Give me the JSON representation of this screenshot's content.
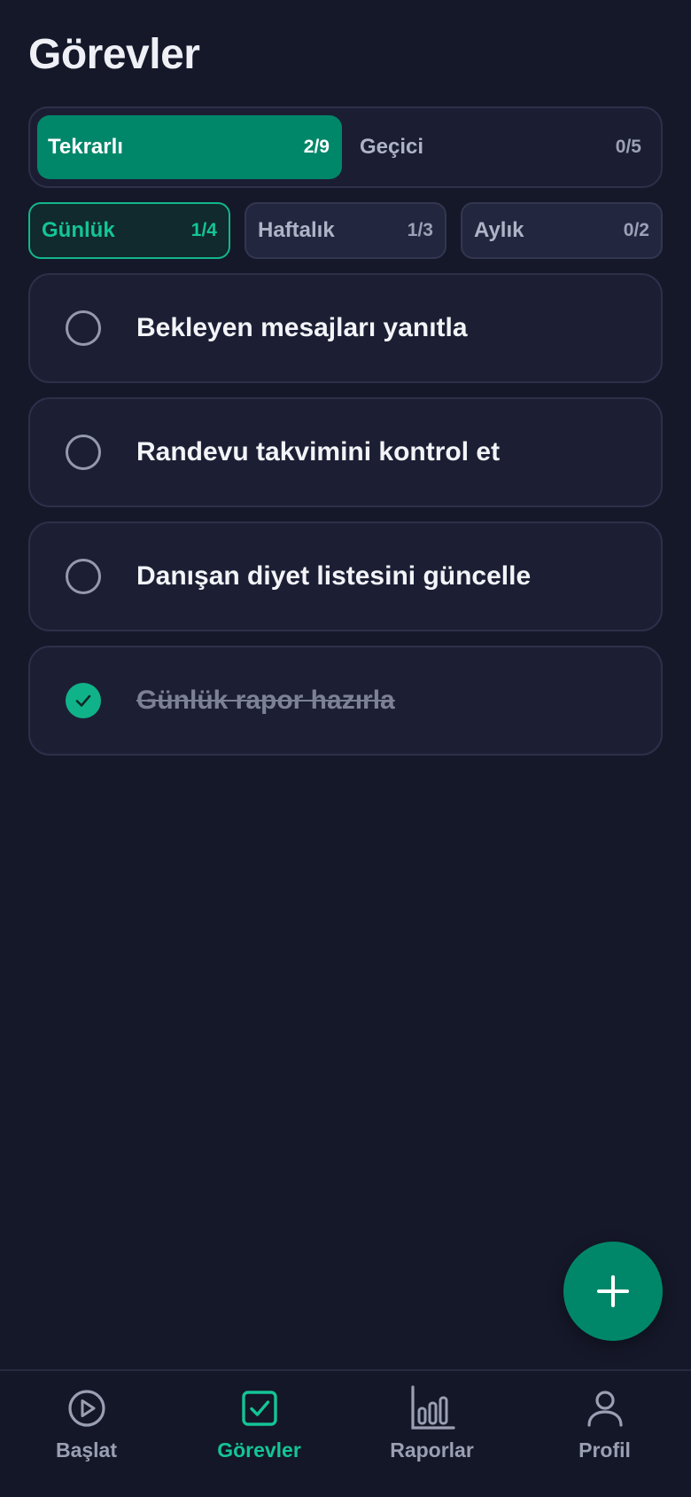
{
  "page": {
    "title": "Görevler"
  },
  "segment": {
    "tabs": [
      {
        "label": "Tekrarlı",
        "count": "2/9",
        "active": true
      },
      {
        "label": "Geçici",
        "count": "0/5",
        "active": false
      }
    ]
  },
  "filters": [
    {
      "label": "Günlük",
      "count": "1/4",
      "active": true
    },
    {
      "label": "Haftalık",
      "count": "1/3",
      "active": false
    },
    {
      "label": "Aylık",
      "count": "0/2",
      "active": false
    }
  ],
  "tasks": [
    {
      "text": "Bekleyen mesajları yanıtla",
      "done": false
    },
    {
      "text": "Randevu takvimini kontrol et",
      "done": false
    },
    {
      "text": "Danışan diyet listesini güncelle",
      "done": false
    },
    {
      "text": "Günlük rapor hazırla",
      "done": true
    }
  ],
  "fab": {
    "icon": "plus-icon"
  },
  "nav": {
    "items": [
      {
        "label": "Başlat",
        "icon": "play-circle-icon",
        "active": false
      },
      {
        "label": "Görevler",
        "icon": "checkbox-icon",
        "active": true
      },
      {
        "label": "Raporlar",
        "icon": "bar-chart-icon",
        "active": false
      },
      {
        "label": "Profil",
        "icon": "user-icon",
        "active": false
      }
    ]
  },
  "colors": {
    "background": "#151829",
    "accent": "#00876a",
    "accent_bright": "#14c497",
    "card": "#1c1f34",
    "muted_text": "#9a9fb3"
  }
}
